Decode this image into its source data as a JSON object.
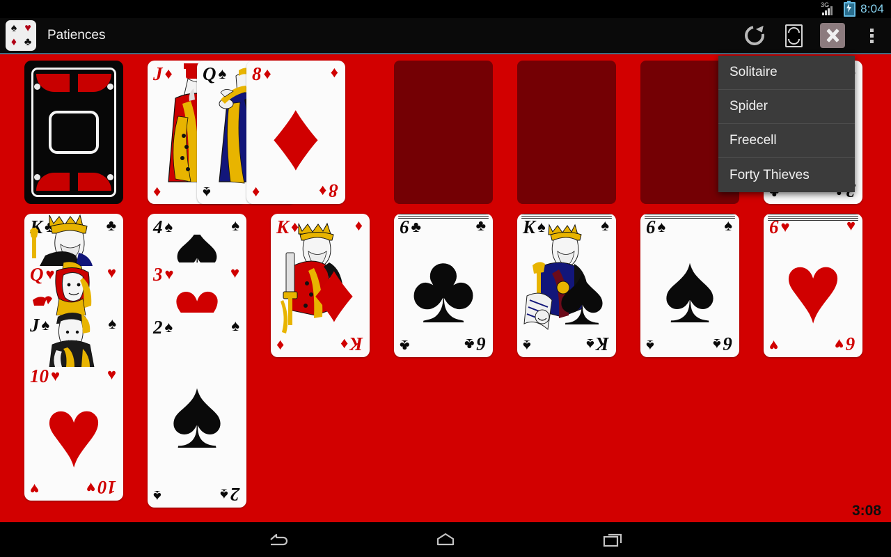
{
  "status_bar": {
    "network": "3G",
    "battery_state": "charging",
    "time": "8:04",
    "clock_color": "#86d2f0"
  },
  "action_bar": {
    "app_icon_suits": [
      "♠",
      "♥",
      "♦",
      "♣"
    ],
    "title": "Patiences",
    "buttons": [
      {
        "name": "restart-icon",
        "label": "Restart"
      },
      {
        "name": "card-back-icon",
        "label": "Deck"
      },
      {
        "name": "close-icon",
        "label": "Close",
        "pressed": true
      },
      {
        "name": "overflow-menu-icon",
        "label": "More options"
      }
    ]
  },
  "menu": {
    "items": [
      {
        "label": "Solitaire"
      },
      {
        "label": "Spider"
      },
      {
        "label": "Freecell"
      },
      {
        "label": "Forty Thieves"
      }
    ]
  },
  "game": {
    "background_color": "#d20000",
    "empty_slot_color": "#740004",
    "timer": "3:08",
    "stock": {
      "type": "card-back"
    },
    "waste": [
      {
        "rank": "J",
        "suit": "♦",
        "color": "red",
        "court": true
      },
      {
        "rank": "Q",
        "suit": "♠",
        "color": "black",
        "court": true
      },
      {
        "rank": "8",
        "suit": "♦",
        "color": "red",
        "court": false
      }
    ],
    "foundations": [
      {
        "empty": true
      },
      {
        "empty": true
      },
      {
        "empty": true
      },
      {
        "rank": "2",
        "suit": "♣",
        "color": "black",
        "court": false
      }
    ],
    "tableau": [
      {
        "facedown": 0,
        "cards": [
          {
            "rank": "K",
            "suit": "♣",
            "color": "black",
            "court": true
          },
          {
            "rank": "Q",
            "suit": "♥",
            "color": "red",
            "court": true
          },
          {
            "rank": "J",
            "suit": "♠",
            "color": "black",
            "court": true
          },
          {
            "rank": "10",
            "suit": "♥",
            "color": "red",
            "court": false
          }
        ]
      },
      {
        "facedown": 0,
        "cards": [
          {
            "rank": "4",
            "suit": "♠",
            "color": "black",
            "court": false
          },
          {
            "rank": "3",
            "suit": "♥",
            "color": "red",
            "court": false
          },
          {
            "rank": "2",
            "suit": "♠",
            "color": "black",
            "court": false
          }
        ]
      },
      {
        "facedown": 0,
        "cards": [
          {
            "rank": "K",
            "suit": "♦",
            "color": "red",
            "court": true
          }
        ]
      },
      {
        "facedown": 4,
        "cards": [
          {
            "rank": "6",
            "suit": "♣",
            "color": "black",
            "court": false
          }
        ]
      },
      {
        "facedown": 4,
        "cards": [
          {
            "rank": "K",
            "suit": "♠",
            "color": "black",
            "court": true
          }
        ]
      },
      {
        "facedown": 4,
        "cards": [
          {
            "rank": "6",
            "suit": "♠",
            "color": "black",
            "court": false
          }
        ]
      },
      {
        "facedown": 5,
        "cards": [
          {
            "rank": "6",
            "suit": "♥",
            "color": "red",
            "court": false
          }
        ]
      }
    ]
  },
  "nav_bar": {
    "buttons": [
      {
        "name": "back-icon",
        "label": "Back"
      },
      {
        "name": "home-icon",
        "label": "Home"
      },
      {
        "name": "recents-icon",
        "label": "Recent apps"
      }
    ]
  }
}
